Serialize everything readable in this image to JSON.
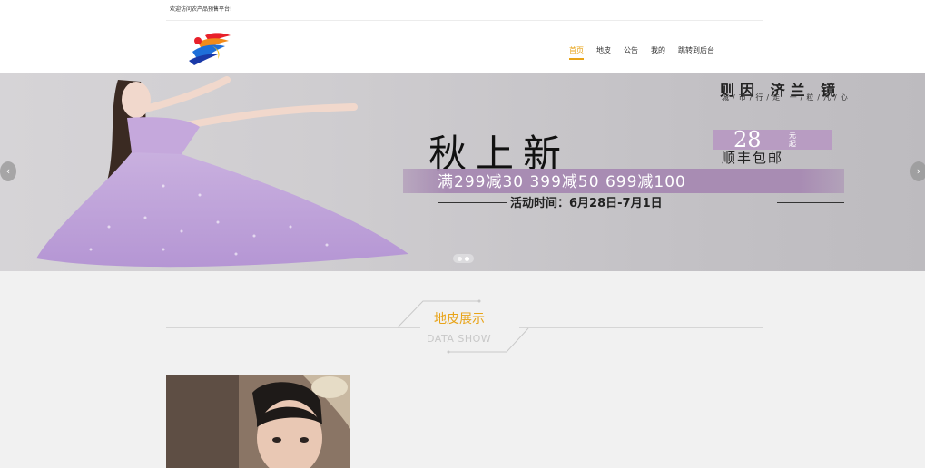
{
  "header": {
    "welcome": "欢迎访问农产品预售平台!"
  },
  "nav": {
    "items": [
      {
        "label": "首页",
        "active": true
      },
      {
        "label": "地皮",
        "active": false
      },
      {
        "label": "公告",
        "active": false
      },
      {
        "label": "我的",
        "active": false
      },
      {
        "label": "跳转到后台",
        "active": false
      }
    ]
  },
  "banner": {
    "brand": "则因 济兰 镜",
    "brand_sub": "城/市/行/走  一/粒/凡/心",
    "title": "秋上新",
    "price": "28",
    "price_unit": "元起",
    "shipping": "顺丰包邮",
    "offer": "满299减30  399减50  699减100",
    "date": "活动时间：6月28日-7月1日",
    "prev_arrow": "‹",
    "next_arrow": "›",
    "slides": 2,
    "active_slide": 2
  },
  "section": {
    "title": "地皮展示",
    "subtitle": "DATA SHOW"
  },
  "colors": {
    "accent": "#e8a317",
    "banner_purple": "#a88cb3"
  }
}
